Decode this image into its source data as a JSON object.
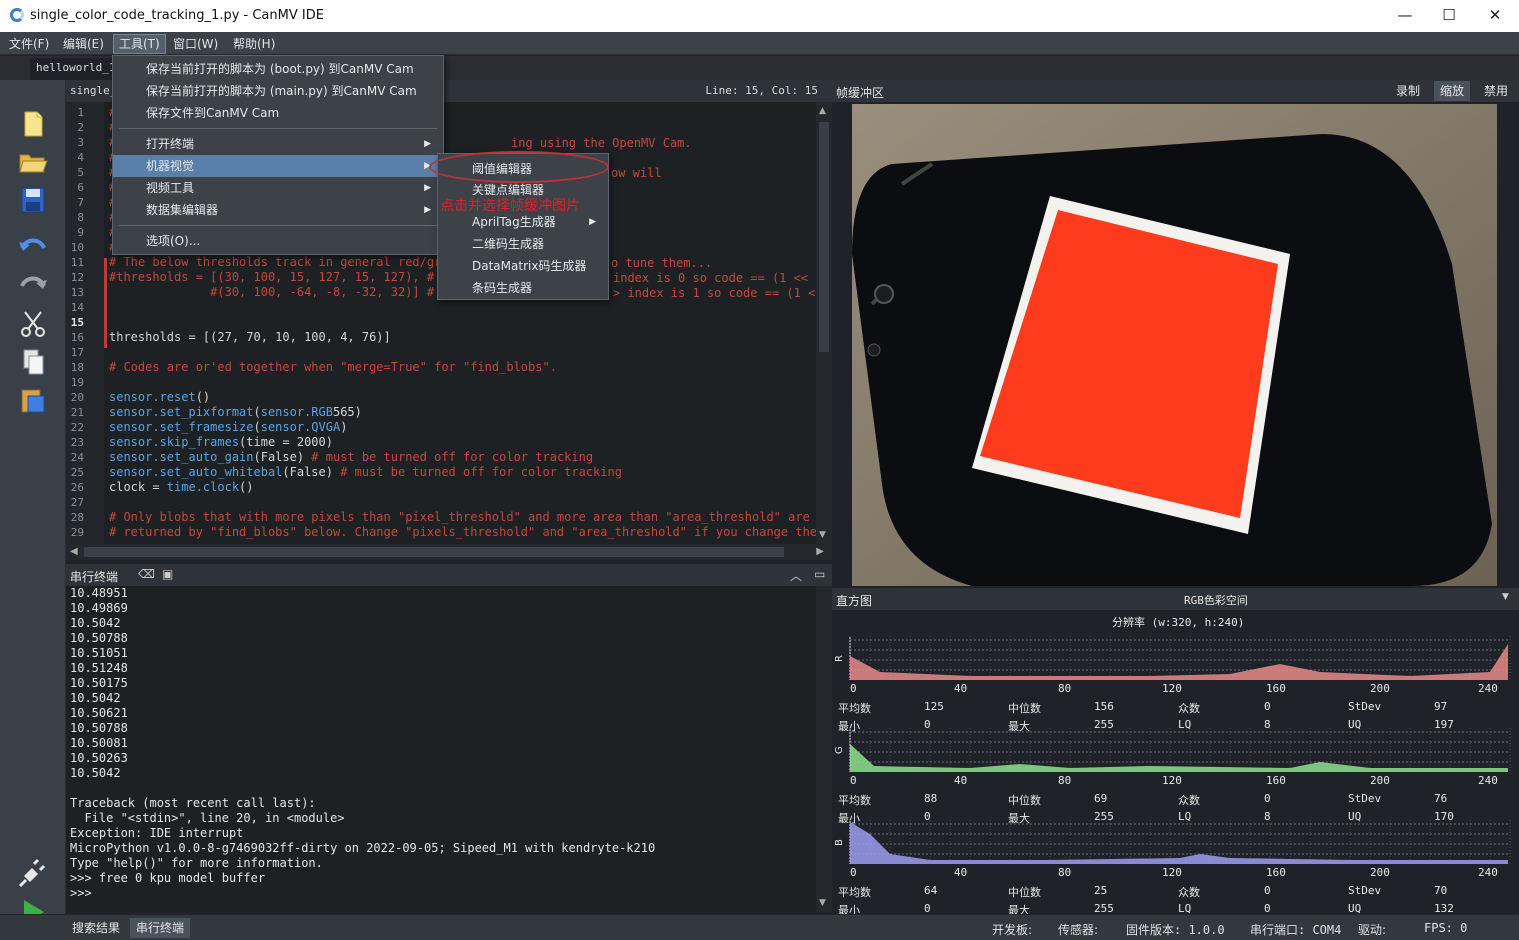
{
  "window": {
    "title": "single_color_code_tracking_1.py - CanMV IDE"
  },
  "menubar": {
    "file": "文件(F)",
    "edit": "编辑(E)",
    "tools": "工具(T)",
    "window": "窗口(W)",
    "help": "帮助(H)"
  },
  "tabs": {
    "file_tab": "helloworld_1.",
    "editor_file": "single_"
  },
  "editor": {
    "position": "Line: 15, Col: 15",
    "lines": [
      {
        "n": "1",
        "t": "#"
      },
      {
        "n": "2",
        "t": "#"
      },
      {
        "n": "3",
        "t": "#"
      },
      {
        "n": "4",
        "t": "#"
      },
      {
        "n": "5",
        "t": "#"
      },
      {
        "n": "6",
        "t": "#"
      },
      {
        "n": "7",
        "t": "#"
      },
      {
        "n": "8",
        "t": "#"
      },
      {
        "n": "9",
        "t": "#"
      },
      {
        "n": "10",
        "t": "#"
      },
      {
        "n": "11",
        "t": "# The below thresholds track in general red/gre"
      },
      {
        "n": "12",
        "t": "#thresholds = [(30, 100, 15, 127, 15, 127), # g"
      },
      {
        "n": "13",
        "t": "              #(30, 100, -64, -8, -32, 32)] # g"
      },
      {
        "n": "14",
        "t": ""
      },
      {
        "n": "15",
        "t": ""
      },
      {
        "n": "16",
        "t": "thresholds = [(27, 70, 10, 100, 4, 76)]"
      },
      {
        "n": "17",
        "t": ""
      },
      {
        "n": "18",
        "t": "# Codes are or'ed together when \"merge=True\" for \"find_blobs\"."
      },
      {
        "n": "19",
        "t": ""
      },
      {
        "n": "20",
        "t": "sensor.reset()"
      },
      {
        "n": "21",
        "t": "sensor.set_pixformat(sensor.RGB565)"
      },
      {
        "n": "22",
        "t": "sensor.set_framesize(sensor.QVGA)"
      },
      {
        "n": "23",
        "t": "sensor.skip_frames(time = 2000)"
      },
      {
        "n": "24",
        "t": "sensor.set_auto_gain(False) # must be turned off for color tracking"
      },
      {
        "n": "25",
        "t": "sensor.set_auto_whitebal(False) # must be turned off for color tracking"
      },
      {
        "n": "26",
        "t": "clock = time.clock()"
      },
      {
        "n": "27",
        "t": ""
      },
      {
        "n": "28",
        "t": "# Only blobs that with more pixels than \"pixel_threshold\" and more area than \"area_threshold\" are"
      },
      {
        "n": "29",
        "t": "# returned by \"find_blobs\" below. Change \"pixels_threshold\" and \"area_threshold\" if you change the"
      }
    ],
    "overflow": {
      "l3": "ing using the OpenMV Cam.",
      "l5": "ow will",
      "l11": "o tune them...",
      "l12": "index is 0 so code == (1 << 0",
      "l13": "> index is 1 so code == (1 <<"
    }
  },
  "dropdown": {
    "save_boot": "保存当前打开的脚本为 (boot.py) 到CanMV Cam",
    "save_main": "保存当前打开的脚本为 (main.py) 到CanMV Cam",
    "save_file": "保存文件到CanMV Cam",
    "open_terminal": "打开终端",
    "machine_vision": "机器视觉",
    "video_tools": "视频工具",
    "dataset_editor": "数据集编辑器",
    "options": "选项(O)..."
  },
  "submenu": {
    "threshold_editor": "阈值编辑器",
    "keypoint_editor": "关键点编辑器",
    "apriltag": "AprilTag生成器",
    "qrcode": "二维码生成器",
    "datamatrix": "DataMatrix码生成器",
    "barcode": "条码生成器"
  },
  "annotation": "点击并选择帧缓冲图片",
  "serial": {
    "title": "串行终端",
    "lines": [
      "10.48951",
      "10.49869",
      "10.5042",
      "10.50788",
      "10.51051",
      "10.51248",
      "10.50175",
      "10.5042",
      "10.50621",
      "10.50788",
      "10.50081",
      "10.50263",
      "10.5042",
      "",
      "Traceback (most recent call last):",
      "  File \"<stdin>\", line 20, in <module>",
      "Exception: IDE interrupt",
      "MicroPython v1.0.0-8-g7469032ff-dirty on 2022-09-05; Sipeed_M1 with kendryte-k210",
      "Type \"help()\" for more information.",
      ">>> free 0 kpu model buffer",
      ">>>"
    ]
  },
  "framebuffer": {
    "title": "帧缓冲区",
    "record": "录制",
    "zoom": "缩放",
    "disable": "禁用"
  },
  "histogram": {
    "title": "直方图",
    "colorspace": "RGB色彩空间",
    "resolution": "分辨率 (w:320, h:240)",
    "ticks": [
      "0",
      "40",
      "80",
      "120",
      "160",
      "200",
      "240"
    ],
    "labels": {
      "mean": "平均数",
      "median": "中位数",
      "mode": "众数",
      "stdev": "StDev",
      "min": "最小",
      "max": "最大",
      "lq": "LQ",
      "uq": "UQ"
    },
    "channels": [
      {
        "name": "R",
        "color": "#e88a8a",
        "mean": "125",
        "median": "156",
        "mode": "0",
        "stdev": "97",
        "min": "0",
        "max": "255",
        "lq": "8",
        "uq": "197"
      },
      {
        "name": "G",
        "color": "#8fe08f",
        "mean": "88",
        "median": "69",
        "mode": "0",
        "stdev": "76",
        "min": "0",
        "max": "255",
        "lq": "8",
        "uq": "170"
      },
      {
        "name": "B",
        "color": "#9c9cf0",
        "mean": "64",
        "median": "25",
        "mode": "0",
        "stdev": "70",
        "min": "0",
        "max": "255",
        "lq": "0",
        "uq": "132"
      }
    ]
  },
  "bottom_tabs": {
    "search": "搜索结果",
    "serial": "串行终端"
  },
  "status": {
    "board": "开发板:",
    "sensor": "传感器:",
    "firmware": "固件版本: 1.0.0",
    "port": "串行端口: COM4",
    "driver": "驱动:",
    "fps": "FPS: 0"
  }
}
